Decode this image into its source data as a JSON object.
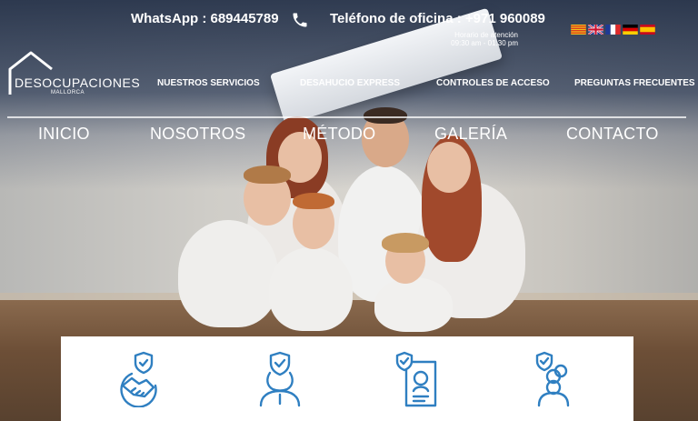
{
  "contact": {
    "whatsapp": "WhatsApp : 689445789",
    "office_phone": "Teléfono de oficina : +971 960089",
    "hours_label": "Horario de atención",
    "hours_value": "09:30 am - 01:30 pm"
  },
  "languages": [
    {
      "code": "ca",
      "icon": "catalan-flag-icon"
    },
    {
      "code": "en",
      "icon": "uk-flag-icon"
    },
    {
      "code": "fr",
      "icon": "french-flag-icon"
    },
    {
      "code": "de",
      "icon": "german-flag-icon"
    },
    {
      "code": "es",
      "icon": "spanish-flag-icon"
    }
  ],
  "logo": {
    "name": "DESOCUPACIONES",
    "sub": "MALLORCA"
  },
  "top_nav": [
    {
      "label": "NUESTROS SERVICIOS"
    },
    {
      "label": "DESAHUCIO EXPRESS"
    },
    {
      "label": "CONTROLES DE ACCESO"
    },
    {
      "label": "PREGUNTAS FRECUENTES"
    }
  ],
  "main_nav": [
    {
      "label": "INICIO"
    },
    {
      "label": "NOSOTROS"
    },
    {
      "label": "MÉTODO"
    },
    {
      "label": "GALERÍA"
    },
    {
      "label": "CONTACTO"
    }
  ],
  "feature_icons": [
    "handshake-shield-icon",
    "person-shield-icon",
    "document-shield-icon",
    "coins-shield-icon"
  ],
  "colors": {
    "accent_blue": "#2f7fc1",
    "header_dark": "#212e46",
    "text": "#ffffff"
  }
}
